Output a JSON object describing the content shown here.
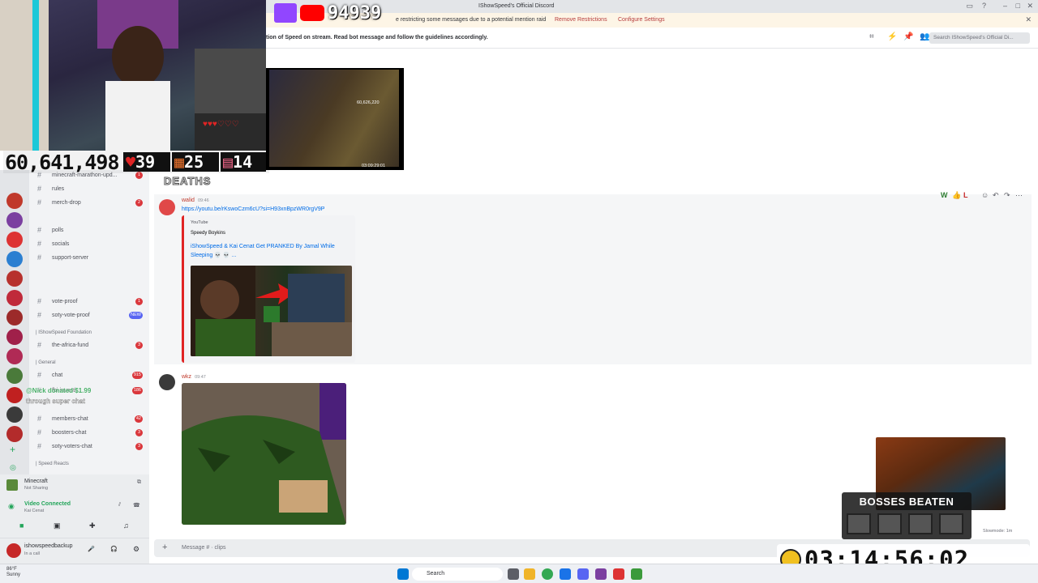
{
  "window": {
    "title": "IShowSpeed's Official Discord"
  },
  "notice": {
    "text": "e restricting some messages due to a potential mention raid",
    "remove": "Remove Restrictions",
    "configure": "Configure Settings"
  },
  "header": {
    "topic": "tion of Speed on stream. Read bot message and follow the guidelines accordingly.",
    "search_placeholder": "Search IShowSpeed's Official Di..."
  },
  "sidebar": {
    "channels": [
      {
        "name": "minecraft-marathon-upd...",
        "badge": "1"
      },
      {
        "name": "rules",
        "badge": ""
      },
      {
        "name": "merch-drop",
        "badge": "2"
      },
      {
        "name": "polls",
        "badge": ""
      },
      {
        "name": "socials",
        "badge": ""
      },
      {
        "name": "support-server",
        "badge": ""
      },
      {
        "name": "vote-proof",
        "badge": "1"
      },
      {
        "name": "soty-vote-proof",
        "badge": "NEW"
      },
      {
        "name": "the-africa-fund",
        "badge": "3"
      },
      {
        "name": "chat",
        "badge": "915"
      },
      {
        "name": "fbi-investi...",
        "badge": "186"
      },
      {
        "name": "members-chat",
        "badge": "42"
      },
      {
        "name": "boosters-chat",
        "badge": "3"
      },
      {
        "name": "soty-voters-chat",
        "badge": "3"
      }
    ],
    "categories": {
      "foundation": "| IShowSpeed Foundation",
      "general": "| General",
      "reacts": "| Speed Reacts"
    }
  },
  "voice": {
    "activity": "Minecraft",
    "activity_sub": "Not Sharing",
    "status": "Video Connected",
    "status_sub": "Kai Cenat"
  },
  "user": {
    "name": "ishowspeedbackup",
    "status": "In a call"
  },
  "messages": [
    {
      "author": "walid",
      "time": "09:46",
      "link": "https://youtu.be/rKswoCzm6cU?si=H93xnBpzWR0rgV9P",
      "embed": {
        "provider": "YouTube",
        "channel": "Speedy Boykins",
        "title": "iShowSpeed & Kai Cenat Get PRANKED By Jamal While Sleeping 💀 💀 ..."
      }
    },
    {
      "author": "wkz",
      "time": "09:47"
    }
  ],
  "composer": {
    "placeholder": "Message # · clips"
  },
  "slowmode": "Slowmode: 1m",
  "overlay": {
    "subscribers": "94939",
    "big_count": "60,641,498",
    "hearts": "39",
    "blocks": "25",
    "kills": "14",
    "deaths_label": "DEATHS",
    "game_counter": "60,626,220",
    "game_timer": "03:09:29:01",
    "bosses_label": "BOSSES BEATEN",
    "timer": "03:14:56:02",
    "cheer_text": "@Nick donated $1.99",
    "cheer_sub": "through super chat"
  },
  "taskbar": {
    "search": "Search",
    "weather_temp": "86°F",
    "weather_cond": "Sunny"
  },
  "colors": {
    "brand_red": "#da373c",
    "link_blue": "#006ce7",
    "blurple": "#5865f2"
  }
}
